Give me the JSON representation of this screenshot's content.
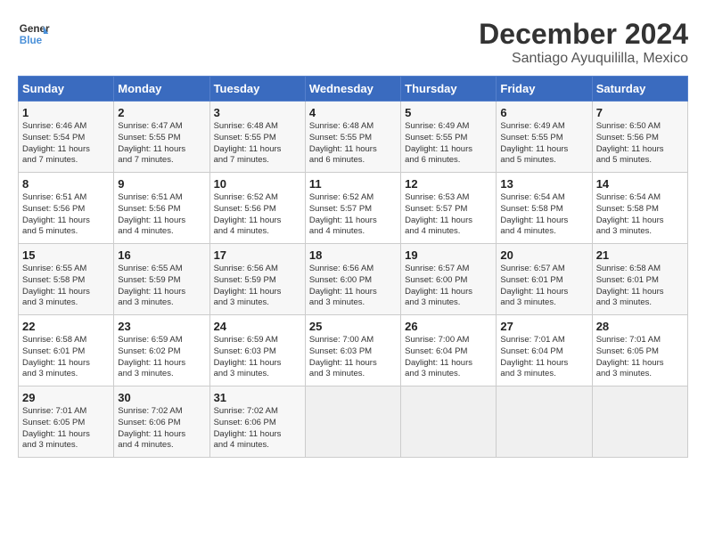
{
  "header": {
    "logo_line1": "General",
    "logo_line2": "Blue",
    "month": "December 2024",
    "location": "Santiago Ayuquililla, Mexico"
  },
  "weekdays": [
    "Sunday",
    "Monday",
    "Tuesday",
    "Wednesday",
    "Thursday",
    "Friday",
    "Saturday"
  ],
  "weeks": [
    [
      {
        "day": "1",
        "info": "Sunrise: 6:46 AM\nSunset: 5:54 PM\nDaylight: 11 hours\nand 7 minutes."
      },
      {
        "day": "2",
        "info": "Sunrise: 6:47 AM\nSunset: 5:55 PM\nDaylight: 11 hours\nand 7 minutes."
      },
      {
        "day": "3",
        "info": "Sunrise: 6:48 AM\nSunset: 5:55 PM\nDaylight: 11 hours\nand 7 minutes."
      },
      {
        "day": "4",
        "info": "Sunrise: 6:48 AM\nSunset: 5:55 PM\nDaylight: 11 hours\nand 6 minutes."
      },
      {
        "day": "5",
        "info": "Sunrise: 6:49 AM\nSunset: 5:55 PM\nDaylight: 11 hours\nand 6 minutes."
      },
      {
        "day": "6",
        "info": "Sunrise: 6:49 AM\nSunset: 5:55 PM\nDaylight: 11 hours\nand 5 minutes."
      },
      {
        "day": "7",
        "info": "Sunrise: 6:50 AM\nSunset: 5:56 PM\nDaylight: 11 hours\nand 5 minutes."
      }
    ],
    [
      {
        "day": "8",
        "info": "Sunrise: 6:51 AM\nSunset: 5:56 PM\nDaylight: 11 hours\nand 5 minutes."
      },
      {
        "day": "9",
        "info": "Sunrise: 6:51 AM\nSunset: 5:56 PM\nDaylight: 11 hours\nand 4 minutes."
      },
      {
        "day": "10",
        "info": "Sunrise: 6:52 AM\nSunset: 5:56 PM\nDaylight: 11 hours\nand 4 minutes."
      },
      {
        "day": "11",
        "info": "Sunrise: 6:52 AM\nSunset: 5:57 PM\nDaylight: 11 hours\nand 4 minutes."
      },
      {
        "day": "12",
        "info": "Sunrise: 6:53 AM\nSunset: 5:57 PM\nDaylight: 11 hours\nand 4 minutes."
      },
      {
        "day": "13",
        "info": "Sunrise: 6:54 AM\nSunset: 5:58 PM\nDaylight: 11 hours\nand 4 minutes."
      },
      {
        "day": "14",
        "info": "Sunrise: 6:54 AM\nSunset: 5:58 PM\nDaylight: 11 hours\nand 3 minutes."
      }
    ],
    [
      {
        "day": "15",
        "info": "Sunrise: 6:55 AM\nSunset: 5:58 PM\nDaylight: 11 hours\nand 3 minutes."
      },
      {
        "day": "16",
        "info": "Sunrise: 6:55 AM\nSunset: 5:59 PM\nDaylight: 11 hours\nand 3 minutes."
      },
      {
        "day": "17",
        "info": "Sunrise: 6:56 AM\nSunset: 5:59 PM\nDaylight: 11 hours\nand 3 minutes."
      },
      {
        "day": "18",
        "info": "Sunrise: 6:56 AM\nSunset: 6:00 PM\nDaylight: 11 hours\nand 3 minutes."
      },
      {
        "day": "19",
        "info": "Sunrise: 6:57 AM\nSunset: 6:00 PM\nDaylight: 11 hours\nand 3 minutes."
      },
      {
        "day": "20",
        "info": "Sunrise: 6:57 AM\nSunset: 6:01 PM\nDaylight: 11 hours\nand 3 minutes."
      },
      {
        "day": "21",
        "info": "Sunrise: 6:58 AM\nSunset: 6:01 PM\nDaylight: 11 hours\nand 3 minutes."
      }
    ],
    [
      {
        "day": "22",
        "info": "Sunrise: 6:58 AM\nSunset: 6:01 PM\nDaylight: 11 hours\nand 3 minutes."
      },
      {
        "day": "23",
        "info": "Sunrise: 6:59 AM\nSunset: 6:02 PM\nDaylight: 11 hours\nand 3 minutes."
      },
      {
        "day": "24",
        "info": "Sunrise: 6:59 AM\nSunset: 6:03 PM\nDaylight: 11 hours\nand 3 minutes."
      },
      {
        "day": "25",
        "info": "Sunrise: 7:00 AM\nSunset: 6:03 PM\nDaylight: 11 hours\nand 3 minutes."
      },
      {
        "day": "26",
        "info": "Sunrise: 7:00 AM\nSunset: 6:04 PM\nDaylight: 11 hours\nand 3 minutes."
      },
      {
        "day": "27",
        "info": "Sunrise: 7:01 AM\nSunset: 6:04 PM\nDaylight: 11 hours\nand 3 minutes."
      },
      {
        "day": "28",
        "info": "Sunrise: 7:01 AM\nSunset: 6:05 PM\nDaylight: 11 hours\nand 3 minutes."
      }
    ],
    [
      {
        "day": "29",
        "info": "Sunrise: 7:01 AM\nSunset: 6:05 PM\nDaylight: 11 hours\nand 3 minutes."
      },
      {
        "day": "30",
        "info": "Sunrise: 7:02 AM\nSunset: 6:06 PM\nDaylight: 11 hours\nand 4 minutes."
      },
      {
        "day": "31",
        "info": "Sunrise: 7:02 AM\nSunset: 6:06 PM\nDaylight: 11 hours\nand 4 minutes."
      },
      {
        "day": "",
        "info": ""
      },
      {
        "day": "",
        "info": ""
      },
      {
        "day": "",
        "info": ""
      },
      {
        "day": "",
        "info": ""
      }
    ]
  ]
}
